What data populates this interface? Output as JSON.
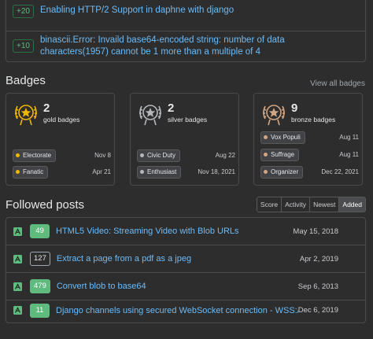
{
  "top_items": [
    {
      "score": "+20",
      "title": "Enabling HTTP/2 Support in daphne with django"
    },
    {
      "score": "+10",
      "title": "binascii.Error: Invaild base64-encoded string: number of data characters(1957) cannot be 1 more than a multiple of 4"
    }
  ],
  "badges": {
    "heading": "Badges",
    "view_all": "View all badges",
    "gold": {
      "count": "2",
      "label": "gold badges",
      "color": "#f1b600",
      "items": [
        {
          "name": "Electorate",
          "date": "Nov 8"
        },
        {
          "name": "Fanatic",
          "date": "Apr 21"
        }
      ]
    },
    "silver": {
      "count": "2",
      "label": "silver badges",
      "color": "#b4b8bc",
      "items": [
        {
          "name": "Civic Duty",
          "date": "Aug 22"
        },
        {
          "name": "Enthusiast",
          "date": "Nov 18, 2021"
        }
      ]
    },
    "bronze": {
      "count": "9",
      "label": "bronze badges",
      "color": "#d1a684",
      "items": [
        {
          "name": "Vox Populi",
          "date": "Aug 11"
        },
        {
          "name": "Suffrage",
          "date": "Aug 11"
        },
        {
          "name": "Organizer",
          "date": "Dec 22, 2021"
        }
      ]
    }
  },
  "followed": {
    "heading": "Followed posts",
    "tabs": [
      "Score",
      "Activity",
      "Newest",
      "Added"
    ],
    "active_tab": "Added",
    "posts": [
      {
        "score": "49",
        "accepted": true,
        "title": "HTML5 Video: Streaming Video with Blob URLs",
        "date": "May 15, 2018"
      },
      {
        "score": "127",
        "accepted": false,
        "title": "Extract a page from a pdf as a jpeg",
        "date": "Apr 2, 2019"
      },
      {
        "score": "479",
        "accepted": true,
        "title": "Convert blob to base64",
        "date": "Sep 6, 2013"
      },
      {
        "score": "11",
        "accepted": true,
        "title": "Django channels using secured WebSocket connection - WSS://",
        "date": "Dec 6, 2019"
      }
    ]
  },
  "colors": {
    "link": "#6cbbf7",
    "accepted": "#5eba7d",
    "background": "#2d2d2d"
  }
}
